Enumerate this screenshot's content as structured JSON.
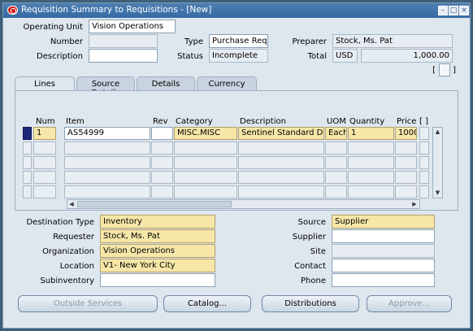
{
  "window": {
    "title": "Requisition Summary to Requisitions - [New]",
    "controls": [
      "minimize-icon",
      "maximize-icon",
      "close-icon"
    ]
  },
  "header": {
    "operating_unit_label": "Operating Unit",
    "operating_unit": "Vision Operations",
    "number_label": "Number",
    "number": "",
    "type_label": "Type",
    "type": "Purchase Requi",
    "preparer_label": "Preparer",
    "preparer": "Stock, Ms. Pat",
    "description_label": "Description",
    "description": "",
    "status_label": "Status",
    "status": "Incomplete",
    "total_label": "Total",
    "currency": "USD",
    "total": "1,000.00",
    "bracket_left": "[",
    "bracket_right": "]"
  },
  "tabs": [
    {
      "label": "Lines",
      "active": true
    },
    {
      "label": "Source Details",
      "active": false
    },
    {
      "label": "Details",
      "active": false
    },
    {
      "label": "Currency",
      "active": false
    }
  ],
  "lines": {
    "columns": [
      "Num",
      "Item",
      "Rev",
      "Category",
      "Description",
      "UOM",
      "Quantity",
      "Price",
      "[ ]"
    ],
    "rows": [
      {
        "num": "1",
        "item": "AS54999",
        "rev": "",
        "category": "MISC.MISC",
        "description": "Sentinel Standard Deskt",
        "uom": "Each",
        "quantity": "1",
        "price": "1000"
      },
      {
        "num": "",
        "item": "",
        "rev": "",
        "category": "",
        "description": "",
        "uom": "",
        "quantity": "",
        "price": ""
      },
      {
        "num": "",
        "item": "",
        "rev": "",
        "category": "",
        "description": "",
        "uom": "",
        "quantity": "",
        "price": ""
      },
      {
        "num": "",
        "item": "",
        "rev": "",
        "category": "",
        "description": "",
        "uom": "",
        "quantity": "",
        "price": ""
      },
      {
        "num": "",
        "item": "",
        "rev": "",
        "category": "",
        "description": "",
        "uom": "",
        "quantity": "",
        "price": ""
      }
    ]
  },
  "details": {
    "destination_type_label": "Destination Type",
    "destination_type": "Inventory",
    "requester_label": "Requester",
    "requester": "Stock, Ms. Pat",
    "organization_label": "Organization",
    "organization": "Vision Operations",
    "location_label": "Location",
    "location": "V1- New York City",
    "subinventory_label": "Subinventory",
    "subinventory": "",
    "source_label": "Source",
    "source": "Supplier",
    "supplier_label": "Supplier",
    "supplier": "",
    "site_label": "Site",
    "site": "",
    "contact_label": "Contact",
    "contact": "",
    "phone_label": "Phone",
    "phone": ""
  },
  "buttons": {
    "outside_services": "Outside Services",
    "catalog": "Catalog...",
    "distributions": "Distributions",
    "approve": "Approve..."
  },
  "colors": {
    "required": "#f6e6a8",
    "titlebar": "#356aa3",
    "current_row": "#1c2a7a"
  }
}
